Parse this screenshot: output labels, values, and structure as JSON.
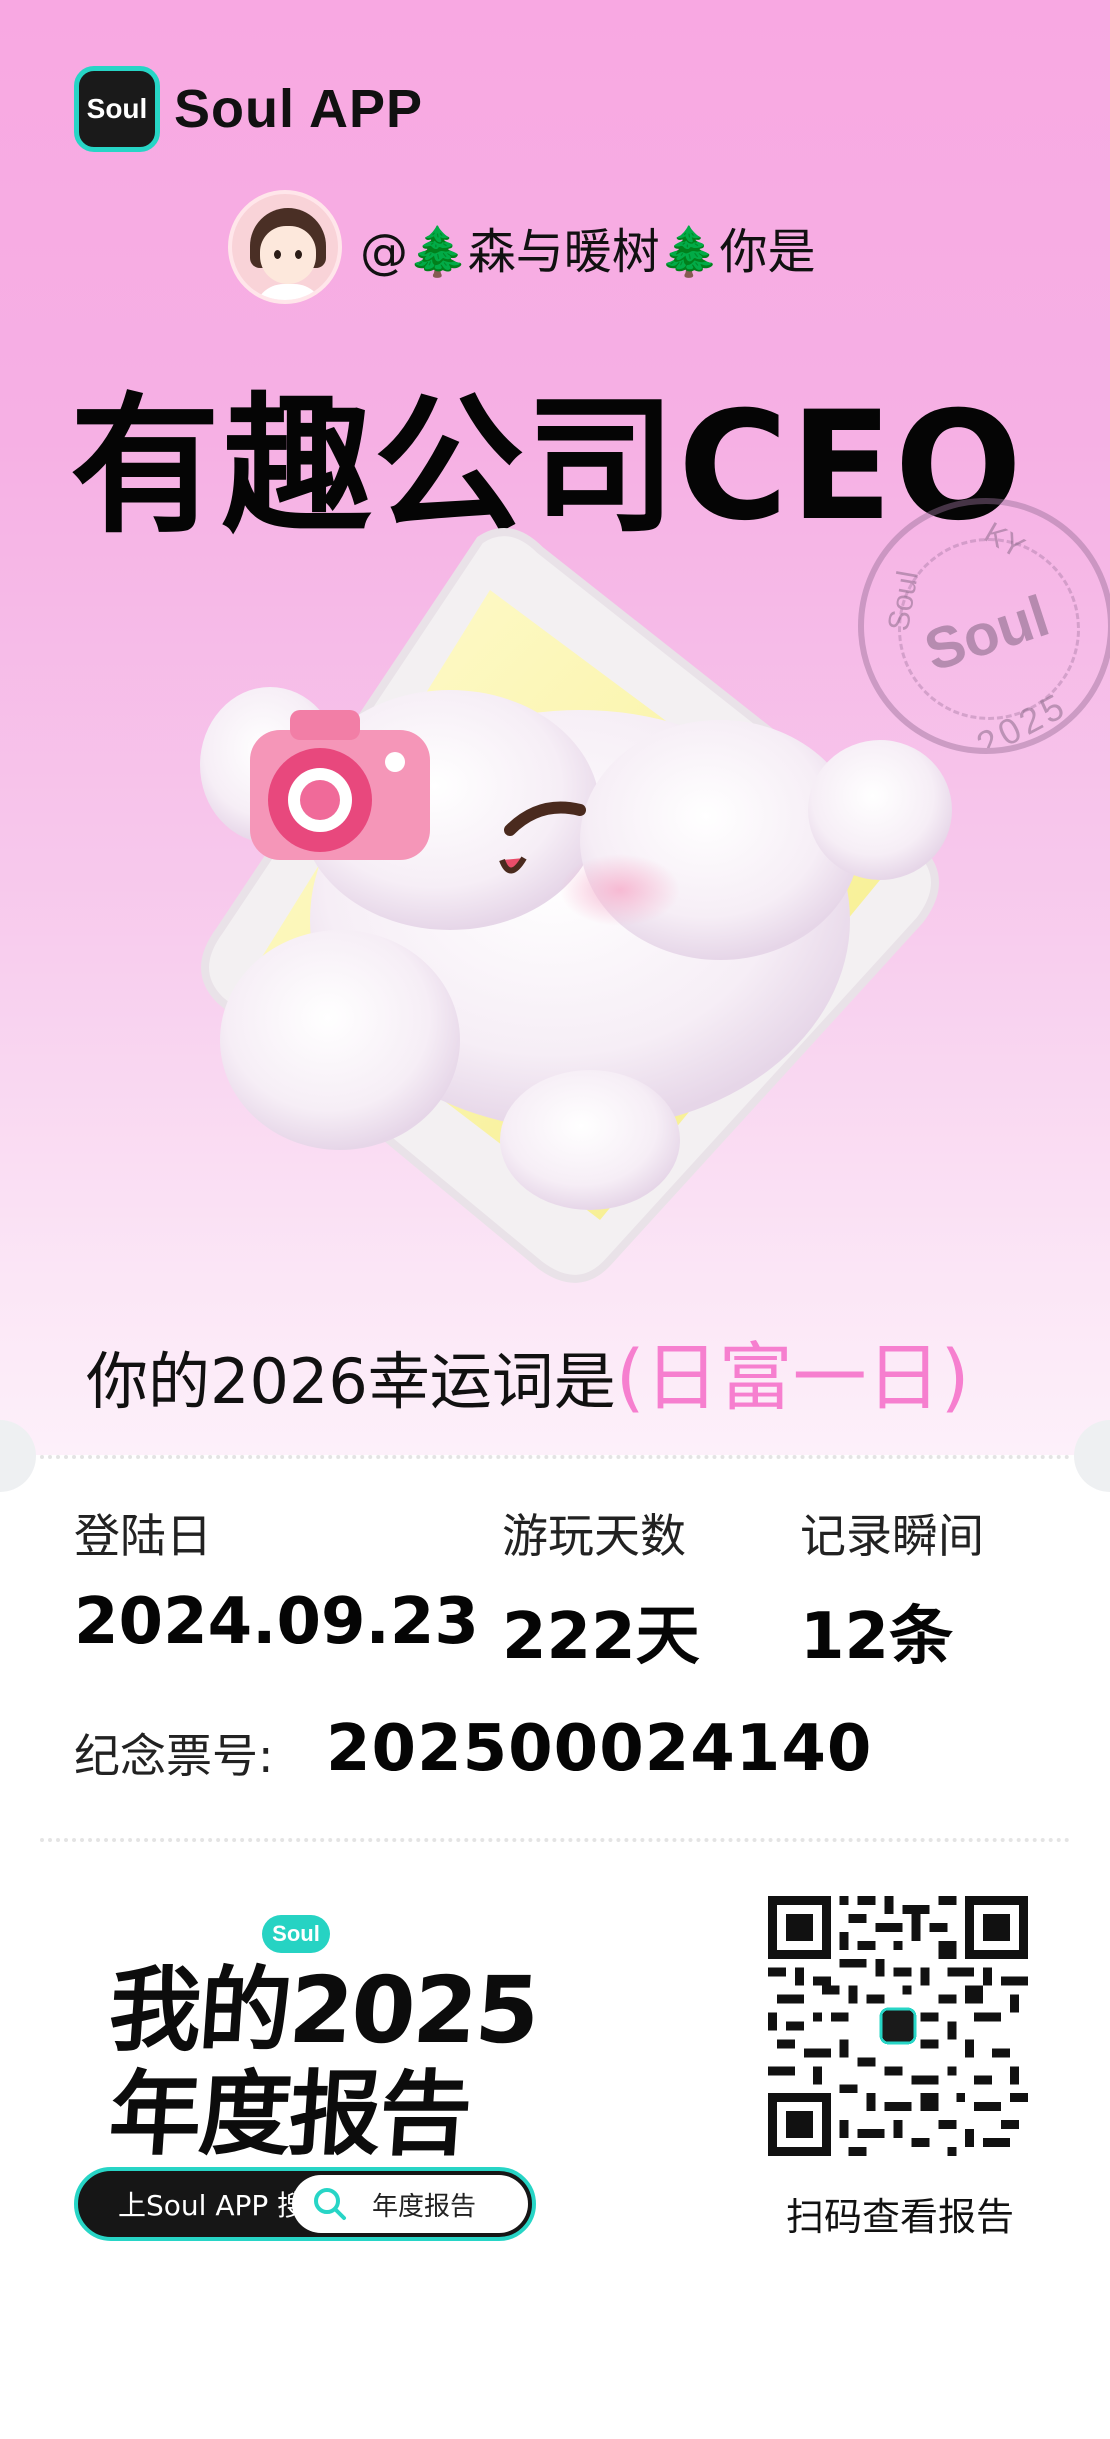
{
  "app": {
    "brand_icon_text": "Soul",
    "brand_name": "Soul APP"
  },
  "user": {
    "greeting": "@🌲森与暖树🌲你是"
  },
  "persona": {
    "title": "有趣公司CEO"
  },
  "stamp": {
    "brand": "Soul",
    "ring_top": "KY",
    "ring_side": "Soul",
    "year": "2025"
  },
  "lucky": {
    "prefix": "你的2026幸运词是",
    "word": "(日富一日)"
  },
  "stats": [
    {
      "label": "登陆日",
      "value": "2024.09.23"
    },
    {
      "label": "游玩天数",
      "value": "222天"
    },
    {
      "label": "记录瞬间",
      "value": "12条"
    }
  ],
  "ticket": {
    "label": "纪念票号:",
    "number": "202500024140"
  },
  "report": {
    "badge": "Soul",
    "line1": "我的2025",
    "line2": "年度报告",
    "search_lead": "上Soul APP 搜",
    "search_term": "年度报告"
  },
  "qr": {
    "caption": "扫码查看报告"
  },
  "colors": {
    "accent_pink": "#f67fcf",
    "teal": "#27d5c6",
    "hero_pink": "#f8a8e2"
  }
}
